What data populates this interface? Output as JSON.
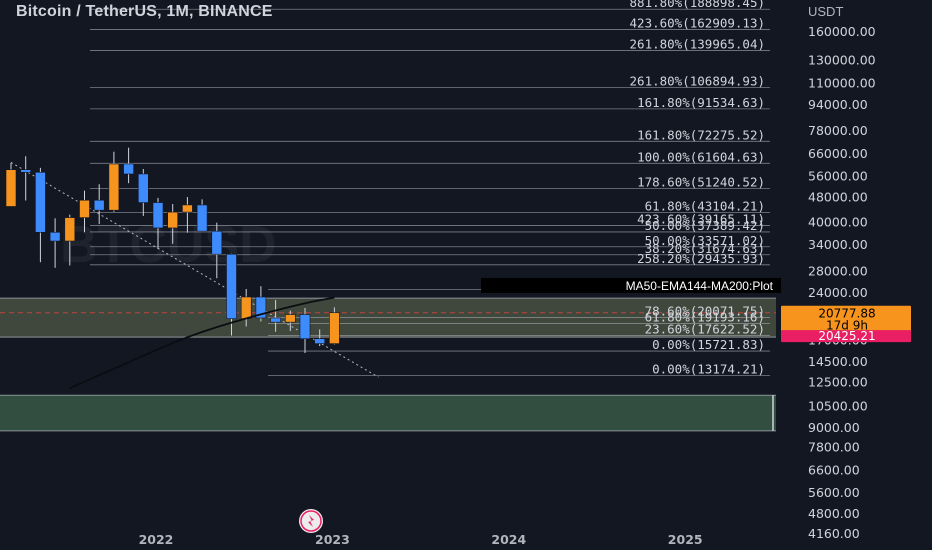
{
  "header": {
    "title": "Bitcoin / TetherUS, 1M, BINANCE",
    "currency": "USDT"
  },
  "watermark": "BTCUSD",
  "colors": {
    "background": "#131722",
    "bull": "#f7941d",
    "bear": "#3d8bfd",
    "price_badge": "#f7941d",
    "secondary_badge": "#e91e63",
    "fib_zone": "#b8c88a",
    "bottom_zone": "#4a7c59",
    "grid_line": "#d1d4dc"
  },
  "price_badges": [
    {
      "name": "last-price",
      "text": "20777.88",
      "sub": "17d 9h",
      "value": 20777.88,
      "color": "#f7941d",
      "text_color": "#000000"
    },
    {
      "name": "secondary-price",
      "text": "20425.21",
      "value": 20425.21,
      "color": "#e91e63",
      "text_color": "#ffffff"
    }
  ],
  "indicator_label": "MA50-EMA144-MA200:Plot",
  "logo": "tradingview-logo-icon",
  "chart_data": {
    "type": "candlestick",
    "title": "Bitcoin / TetherUS, 1M, BINANCE",
    "y_scale": "log",
    "ylim": [
      3700,
      202000
    ],
    "y_ticks": [
      "160000.00",
      "130000.00",
      "110000.00",
      "94000.00",
      "78000.00",
      "66000.00",
      "56000.00",
      "48000.00",
      "40000.00",
      "34000.00",
      "28000.00",
      "24000.00",
      "20000.00",
      "17000.00",
      "14500.00",
      "12500.00",
      "10500.00",
      "9000.00",
      "7800.00",
      "6600.00",
      "5600.00",
      "4800.00",
      "4160.00"
    ],
    "x_ticks": [
      {
        "label": "2022",
        "index": 10
      },
      {
        "label": "2023",
        "index": 22
      },
      {
        "label": "2024",
        "index": 34
      },
      {
        "label": "2025",
        "index": 46
      }
    ],
    "candles": [
      {
        "date": "2021-03",
        "open": 45000,
        "high": 61800,
        "low": 45000,
        "close": 58800
      },
      {
        "date": "2021-04",
        "open": 58800,
        "high": 64850,
        "low": 47000,
        "close": 57700
      },
      {
        "date": "2021-05",
        "open": 57700,
        "high": 59600,
        "low": 30000,
        "close": 37300
      },
      {
        "date": "2021-06",
        "open": 37300,
        "high": 41300,
        "low": 28800,
        "close": 35000
      },
      {
        "date": "2021-07",
        "open": 35000,
        "high": 42400,
        "low": 29300,
        "close": 41500
      },
      {
        "date": "2021-08",
        "open": 41500,
        "high": 50500,
        "low": 37300,
        "close": 47100
      },
      {
        "date": "2021-09",
        "open": 47100,
        "high": 52900,
        "low": 39600,
        "close": 43800
      },
      {
        "date": "2021-10",
        "open": 43800,
        "high": 67000,
        "low": 43300,
        "close": 61300
      },
      {
        "date": "2021-11",
        "open": 61300,
        "high": 69000,
        "low": 53300,
        "close": 57000
      },
      {
        "date": "2021-12",
        "open": 57000,
        "high": 59100,
        "low": 42000,
        "close": 46300
      },
      {
        "date": "2022-01",
        "open": 46300,
        "high": 47900,
        "low": 33000,
        "close": 38500
      },
      {
        "date": "2022-02",
        "open": 38500,
        "high": 45800,
        "low": 34300,
        "close": 43200
      },
      {
        "date": "2022-03",
        "open": 43200,
        "high": 48200,
        "low": 37200,
        "close": 45500
      },
      {
        "date": "2022-04",
        "open": 45500,
        "high": 47400,
        "low": 37600,
        "close": 37600
      },
      {
        "date": "2022-05",
        "open": 37600,
        "high": 40000,
        "low": 26700,
        "close": 31800
      },
      {
        "date": "2022-06",
        "open": 31800,
        "high": 31900,
        "low": 17600,
        "close": 19900
      },
      {
        "date": "2022-07",
        "open": 19900,
        "high": 24700,
        "low": 18800,
        "close": 23300
      },
      {
        "date": "2022-08",
        "open": 23300,
        "high": 25200,
        "low": 19500,
        "close": 20000
      },
      {
        "date": "2022-09",
        "open": 20000,
        "high": 22800,
        "low": 18100,
        "close": 19400
      },
      {
        "date": "2022-10",
        "open": 19400,
        "high": 21100,
        "low": 18200,
        "close": 20500
      },
      {
        "date": "2022-11",
        "open": 20500,
        "high": 21500,
        "low": 15500,
        "close": 17200
      },
      {
        "date": "2022-12",
        "open": 17200,
        "high": 18400,
        "low": 16300,
        "close": 16600
      },
      {
        "date": "2023-01",
        "open": 16600,
        "high": 21600,
        "low": 16500,
        "close": 20777.88
      }
    ],
    "moving_average": [
      {
        "index": 4,
        "value": 12000
      },
      {
        "index": 8,
        "value": 14500
      },
      {
        "index": 12,
        "value": 17500
      },
      {
        "index": 16,
        "value": 20000
      },
      {
        "index": 20,
        "value": 22300
      },
      {
        "index": 22,
        "value": 23200
      }
    ],
    "trendline": {
      "start": {
        "index": 0,
        "value": 62000
      },
      "end": {
        "index": 25,
        "value": 13000
      }
    },
    "fib_levels": [
      {
        "label": "881.80%(188898.45)",
        "value": 188898.45
      },
      {
        "label": "423.60%(162909.13)",
        "value": 162909.13
      },
      {
        "label": "261.80%(139965.04)",
        "value": 139965.04
      },
      {
        "label": "261.80%(106894.93)",
        "value": 106894.93
      },
      {
        "label": "161.80%(91534.63)",
        "value": 91534.63
      },
      {
        "label": "161.80%(72275.52)",
        "value": 72275.52
      },
      {
        "label": "100.00%(61604.63)",
        "value": 61604.63
      },
      {
        "label": "178.60%(51240.52)",
        "value": 51240.52
      },
      {
        "label": "61.80%(43104.21)",
        "value": 43104.21
      },
      {
        "label": "423.60%(39165.11)",
        "value": 39165.11
      },
      {
        "label": "50.00%(37389.42)",
        "value": 37389.42
      },
      {
        "label": "50.00%(33571.02)",
        "value": 33571.02
      },
      {
        "label": "38.20%(31674.63)",
        "value": 31674.63
      },
      {
        "label": "258.20%(29435.93)",
        "value": 29435.93
      },
      {
        "label": "123.60%(24603.79)",
        "value": 24603.79
      },
      {
        "label": "78.60%(20071.75)",
        "value": 20071.75
      },
      {
        "label": "61.80%(19193.16)",
        "value": 19193.16
      },
      {
        "label": "23.60%(17622.52)",
        "value": 17622.52
      },
      {
        "label": "0.00%(15721.83)",
        "value": 15721.83
      },
      {
        "label": "0.00%(13174.21)",
        "value": 13174.21
      }
    ],
    "zones": [
      {
        "name": "fib-zone",
        "from": 17400,
        "to": 23100
      },
      {
        "name": "bottom-zone",
        "from": 8800,
        "to": 11400
      }
    ],
    "grid": false,
    "legend": "none"
  }
}
